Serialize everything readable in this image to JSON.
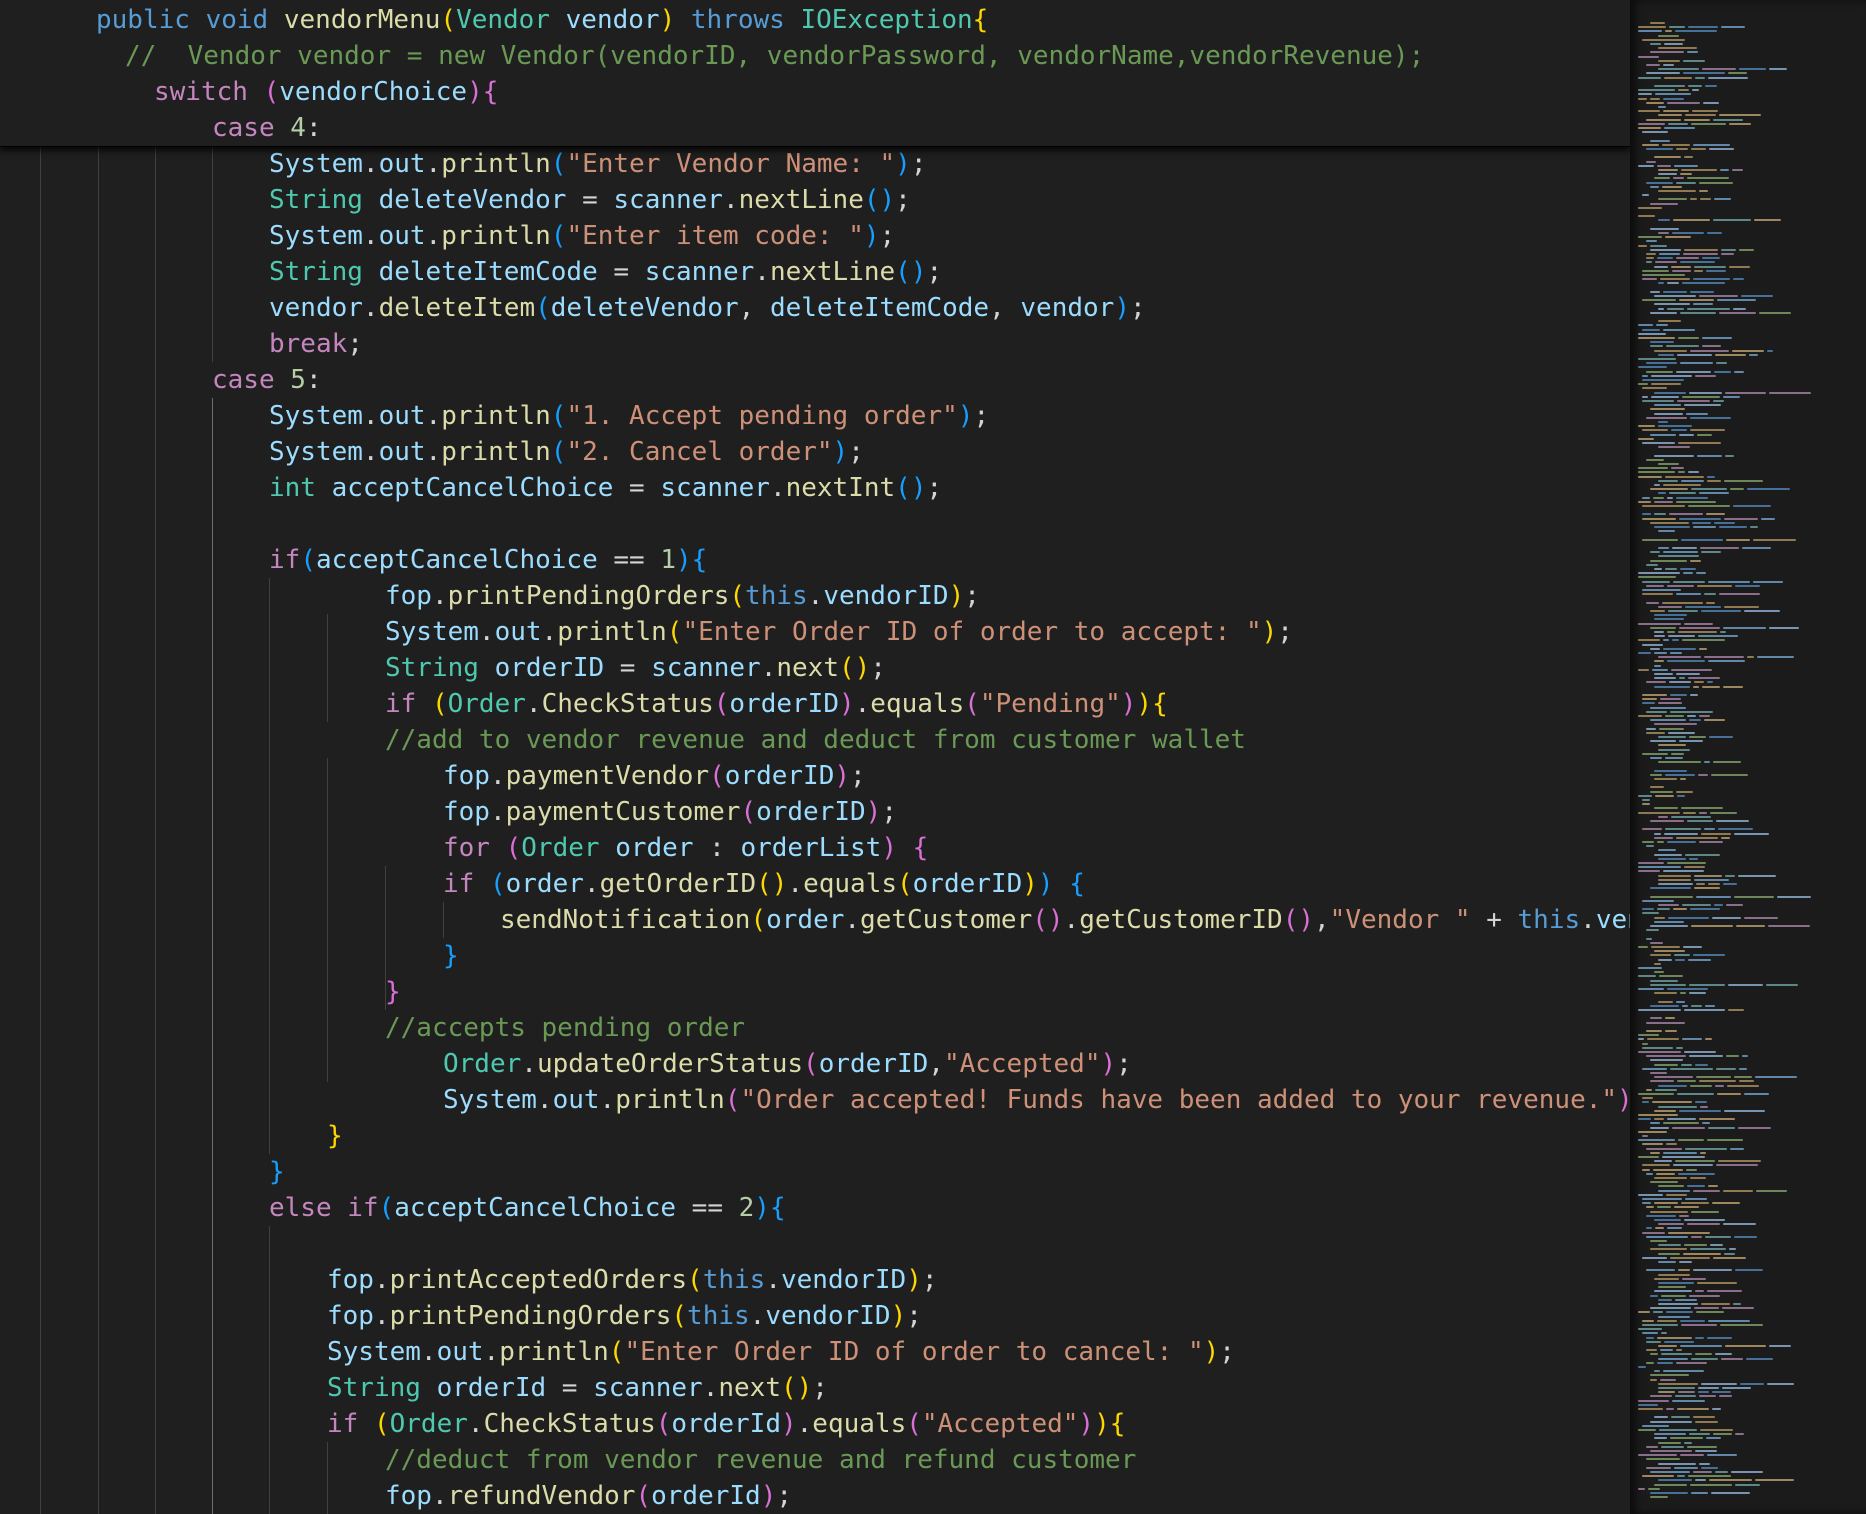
{
  "editor": {
    "sticky_lines": [
      [
        [
          "kw",
          "public "
        ],
        [
          "kw",
          "void "
        ],
        [
          "fn",
          "vendorMenu"
        ],
        [
          "b1",
          "("
        ],
        [
          "typ",
          "Vendor "
        ],
        [
          "var",
          "vendor"
        ],
        [
          "b1",
          ")"
        ],
        [
          "pun",
          " "
        ],
        [
          "kw",
          "throws "
        ],
        [
          "typ",
          "IOException"
        ],
        [
          "b1",
          "{"
        ]
      ],
      [
        [
          "cmt",
          "//  Vendor vendor = new Vendor(vendorID, vendorPassword, vendorName,vendorRevenue);"
        ]
      ],
      [
        [
          "ctl",
          "switch "
        ],
        [
          "b2",
          "("
        ],
        [
          "var",
          "vendorChoice"
        ],
        [
          "b2",
          ")"
        ],
        [
          "b2",
          "{"
        ]
      ],
      [
        [
          "ctl",
          "case "
        ],
        [
          "num",
          "4"
        ],
        [
          "pun",
          ":"
        ]
      ]
    ],
    "lines": [
      [
        [
          "var",
          "System"
        ],
        [
          "pun",
          "."
        ],
        [
          "var",
          "out"
        ],
        [
          "pun",
          "."
        ],
        [
          "fn",
          "println"
        ],
        [
          "b3",
          "("
        ],
        [
          "str",
          "\"Enter Vendor Name: \""
        ],
        [
          "b3",
          ")"
        ],
        [
          "pun",
          ";"
        ]
      ],
      [
        [
          "typ",
          "String "
        ],
        [
          "var",
          "deleteVendor"
        ],
        [
          "pun",
          " = "
        ],
        [
          "var",
          "scanner"
        ],
        [
          "pun",
          "."
        ],
        [
          "fn",
          "nextLine"
        ],
        [
          "b3",
          "()"
        ],
        [
          "pun",
          ";"
        ]
      ],
      [
        [
          "var",
          "System"
        ],
        [
          "pun",
          "."
        ],
        [
          "var",
          "out"
        ],
        [
          "pun",
          "."
        ],
        [
          "fn",
          "println"
        ],
        [
          "b3",
          "("
        ],
        [
          "str",
          "\"Enter item code: \""
        ],
        [
          "b3",
          ")"
        ],
        [
          "pun",
          ";"
        ]
      ],
      [
        [
          "typ",
          "String "
        ],
        [
          "var",
          "deleteItemCode"
        ],
        [
          "pun",
          " = "
        ],
        [
          "var",
          "scanner"
        ],
        [
          "pun",
          "."
        ],
        [
          "fn",
          "nextLine"
        ],
        [
          "b3",
          "()"
        ],
        [
          "pun",
          ";"
        ]
      ],
      [
        [
          "var",
          "vendor"
        ],
        [
          "pun",
          "."
        ],
        [
          "fn",
          "deleteItem"
        ],
        [
          "b3",
          "("
        ],
        [
          "var",
          "deleteVendor"
        ],
        [
          "pun",
          ", "
        ],
        [
          "var",
          "deleteItemCode"
        ],
        [
          "pun",
          ", "
        ],
        [
          "var",
          "vendor"
        ],
        [
          "b3",
          ")"
        ],
        [
          "pun",
          ";"
        ]
      ],
      [
        [
          "ctl",
          "break"
        ],
        [
          "pun",
          ";"
        ]
      ],
      [
        [
          "ctl",
          "case "
        ],
        [
          "num",
          "5"
        ],
        [
          "pun",
          ":"
        ]
      ],
      [
        [
          "var",
          "System"
        ],
        [
          "pun",
          "."
        ],
        [
          "var",
          "out"
        ],
        [
          "pun",
          "."
        ],
        [
          "fn",
          "println"
        ],
        [
          "b3",
          "("
        ],
        [
          "str",
          "\"1. Accept pending order\""
        ],
        [
          "b3",
          ")"
        ],
        [
          "pun",
          ";"
        ]
      ],
      [
        [
          "var",
          "System"
        ],
        [
          "pun",
          "."
        ],
        [
          "var",
          "out"
        ],
        [
          "pun",
          "."
        ],
        [
          "fn",
          "println"
        ],
        [
          "b3",
          "("
        ],
        [
          "str",
          "\"2. Cancel order\""
        ],
        [
          "b3",
          ")"
        ],
        [
          "pun",
          ";"
        ]
      ],
      [
        [
          "typ",
          "int "
        ],
        [
          "var",
          "acceptCancelChoice"
        ],
        [
          "pun",
          " = "
        ],
        [
          "var",
          "scanner"
        ],
        [
          "pun",
          "."
        ],
        [
          "fn",
          "nextInt"
        ],
        [
          "b3",
          "()"
        ],
        [
          "pun",
          ";"
        ]
      ],
      [],
      [
        [
          "ctl",
          "if"
        ],
        [
          "b3",
          "("
        ],
        [
          "var",
          "acceptCancelChoice"
        ],
        [
          "pun",
          " == "
        ],
        [
          "num",
          "1"
        ],
        [
          "b3",
          ")"
        ],
        [
          "b3",
          "{"
        ]
      ],
      [
        [
          "var",
          "fop"
        ],
        [
          "pun",
          "."
        ],
        [
          "fn",
          "printPendingOrders"
        ],
        [
          "b1",
          "("
        ],
        [
          "kw",
          "this"
        ],
        [
          "pun",
          "."
        ],
        [
          "var",
          "vendorID"
        ],
        [
          "b1",
          ")"
        ],
        [
          "pun",
          ";"
        ]
      ],
      [
        [
          "var",
          "System"
        ],
        [
          "pun",
          "."
        ],
        [
          "var",
          "out"
        ],
        [
          "pun",
          "."
        ],
        [
          "fn",
          "println"
        ],
        [
          "b1",
          "("
        ],
        [
          "str",
          "\"Enter Order ID of order to accept: \""
        ],
        [
          "b1",
          ")"
        ],
        [
          "pun",
          ";"
        ]
      ],
      [
        [
          "typ",
          "String "
        ],
        [
          "var",
          "orderID"
        ],
        [
          "pun",
          " = "
        ],
        [
          "var",
          "scanner"
        ],
        [
          "pun",
          "."
        ],
        [
          "fn",
          "next"
        ],
        [
          "b1",
          "()"
        ],
        [
          "pun",
          ";"
        ]
      ],
      [
        [
          "ctl",
          "if "
        ],
        [
          "b1",
          "("
        ],
        [
          "typ",
          "Order"
        ],
        [
          "pun",
          "."
        ],
        [
          "fn",
          "CheckStatus"
        ],
        [
          "b2",
          "("
        ],
        [
          "var",
          "orderID"
        ],
        [
          "b2",
          ")"
        ],
        [
          "pun",
          "."
        ],
        [
          "fn",
          "equals"
        ],
        [
          "b2",
          "("
        ],
        [
          "str",
          "\"Pending\""
        ],
        [
          "b2",
          ")"
        ],
        [
          "b1",
          ")"
        ],
        [
          "b1",
          "{"
        ]
      ],
      [
        [
          "cmt",
          "//add to vendor revenue and deduct from customer wallet"
        ]
      ],
      [
        [
          "var",
          "fop"
        ],
        [
          "pun",
          "."
        ],
        [
          "fn",
          "paymentVendor"
        ],
        [
          "b2",
          "("
        ],
        [
          "var",
          "orderID"
        ],
        [
          "b2",
          ")"
        ],
        [
          "pun",
          ";"
        ]
      ],
      [
        [
          "var",
          "fop"
        ],
        [
          "pun",
          "."
        ],
        [
          "fn",
          "paymentCustomer"
        ],
        [
          "b2",
          "("
        ],
        [
          "var",
          "orderID"
        ],
        [
          "b2",
          ")"
        ],
        [
          "pun",
          ";"
        ]
      ],
      [
        [
          "ctl",
          "for "
        ],
        [
          "b2",
          "("
        ],
        [
          "typ",
          "Order "
        ],
        [
          "var",
          "order"
        ],
        [
          "pun",
          " : "
        ],
        [
          "var",
          "orderList"
        ],
        [
          "b2",
          ")"
        ],
        [
          "pun",
          " "
        ],
        [
          "b2",
          "{"
        ]
      ],
      [
        [
          "ctl",
          "if "
        ],
        [
          "b3",
          "("
        ],
        [
          "var",
          "order"
        ],
        [
          "pun",
          "."
        ],
        [
          "fn",
          "getOrderID"
        ],
        [
          "b1",
          "()"
        ],
        [
          "pun",
          "."
        ],
        [
          "fn",
          "equals"
        ],
        [
          "b1",
          "("
        ],
        [
          "var",
          "orderID"
        ],
        [
          "b1",
          ")"
        ],
        [
          "b3",
          ")"
        ],
        [
          "pun",
          " "
        ],
        [
          "b3",
          "{"
        ]
      ],
      [
        [
          "fn",
          "sendNotification"
        ],
        [
          "b1",
          "("
        ],
        [
          "var",
          "order"
        ],
        [
          "pun",
          "."
        ],
        [
          "fn",
          "getCustomer"
        ],
        [
          "b2",
          "()"
        ],
        [
          "pun",
          "."
        ],
        [
          "fn",
          "getCustomerID"
        ],
        [
          "b2",
          "()"
        ],
        [
          "pun",
          ","
        ],
        [
          "str",
          "\"Vendor \""
        ],
        [
          "pun",
          " + "
        ],
        [
          "kw",
          "this"
        ],
        [
          "pun",
          "."
        ],
        [
          "var",
          "vendorID"
        ]
      ],
      [
        [
          "b3",
          "}"
        ]
      ],
      [
        [
          "b2",
          "}"
        ]
      ],
      [
        [
          "cmt",
          "//accepts pending order"
        ]
      ],
      [
        [
          "typ",
          "Order"
        ],
        [
          "pun",
          "."
        ],
        [
          "fn",
          "updateOrderStatus"
        ],
        [
          "b2",
          "("
        ],
        [
          "var",
          "orderID"
        ],
        [
          "pun",
          ","
        ],
        [
          "str",
          "\"Accepted\""
        ],
        [
          "b2",
          ")"
        ],
        [
          "pun",
          ";"
        ]
      ],
      [
        [
          "var",
          "System"
        ],
        [
          "pun",
          "."
        ],
        [
          "var",
          "out"
        ],
        [
          "pun",
          "."
        ],
        [
          "fn",
          "println"
        ],
        [
          "b2",
          "("
        ],
        [
          "str",
          "\"Order accepted! Funds have been added to your revenue.\""
        ],
        [
          "b2",
          ")"
        ],
        [
          "pun",
          ";"
        ]
      ],
      [
        [
          "b1",
          "}"
        ]
      ],
      [
        [
          "b3",
          "}"
        ]
      ],
      [
        [
          "ctl",
          "else "
        ],
        [
          "ctl",
          "if"
        ],
        [
          "b3",
          "("
        ],
        [
          "var",
          "acceptCancelChoice"
        ],
        [
          "pun",
          " == "
        ],
        [
          "num",
          "2"
        ],
        [
          "b3",
          ")"
        ],
        [
          "b3",
          "{"
        ]
      ],
      [],
      [
        [
          "var",
          "fop"
        ],
        [
          "pun",
          "."
        ],
        [
          "fn",
          "printAcceptedOrders"
        ],
        [
          "b1",
          "("
        ],
        [
          "kw",
          "this"
        ],
        [
          "pun",
          "."
        ],
        [
          "var",
          "vendorID"
        ],
        [
          "b1",
          ")"
        ],
        [
          "pun",
          ";"
        ]
      ],
      [
        [
          "var",
          "fop"
        ],
        [
          "pun",
          "."
        ],
        [
          "fn",
          "printPendingOrders"
        ],
        [
          "b1",
          "("
        ],
        [
          "kw",
          "this"
        ],
        [
          "pun",
          "."
        ],
        [
          "var",
          "vendorID"
        ],
        [
          "b1",
          ")"
        ],
        [
          "pun",
          ";"
        ]
      ],
      [
        [
          "var",
          "System"
        ],
        [
          "pun",
          "."
        ],
        [
          "var",
          "out"
        ],
        [
          "pun",
          "."
        ],
        [
          "fn",
          "println"
        ],
        [
          "b1",
          "("
        ],
        [
          "str",
          "\"Enter Order ID of order to cancel: \""
        ],
        [
          "b1",
          ")"
        ],
        [
          "pun",
          ";"
        ]
      ],
      [
        [
          "typ",
          "String "
        ],
        [
          "var",
          "orderId"
        ],
        [
          "pun",
          " = "
        ],
        [
          "var",
          "scanner"
        ],
        [
          "pun",
          "."
        ],
        [
          "fn",
          "next"
        ],
        [
          "b1",
          "()"
        ],
        [
          "pun",
          ";"
        ]
      ],
      [
        [
          "ctl",
          "if "
        ],
        [
          "b1",
          "("
        ],
        [
          "typ",
          "Order"
        ],
        [
          "pun",
          "."
        ],
        [
          "fn",
          "CheckStatus"
        ],
        [
          "b2",
          "("
        ],
        [
          "var",
          "orderId"
        ],
        [
          "b2",
          ")"
        ],
        [
          "pun",
          "."
        ],
        [
          "fn",
          "equals"
        ],
        [
          "b2",
          "("
        ],
        [
          "str",
          "\"Accepted\""
        ],
        [
          "b2",
          ")"
        ],
        [
          "b1",
          ")"
        ],
        [
          "b1",
          "{"
        ]
      ],
      [
        [
          "cmt",
          "//deduct from vendor revenue and refund customer"
        ]
      ],
      [
        [
          "var",
          "fop"
        ],
        [
          "pun",
          "."
        ],
        [
          "fn",
          "refundVendor"
        ],
        [
          "b2",
          "("
        ],
        [
          "var",
          "orderId"
        ],
        [
          "b2",
          ")"
        ],
        [
          "pun",
          ";"
        ]
      ]
    ]
  }
}
